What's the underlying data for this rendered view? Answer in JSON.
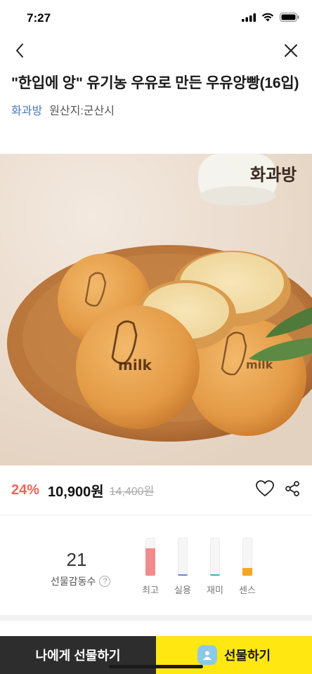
{
  "status_bar": {
    "time": "7:27"
  },
  "nav": {
    "back_icon": "chevron-left-icon",
    "close_icon": "close-icon"
  },
  "product": {
    "title": "\"한입에 앙\" 유기농 우유로 만든 우유앙빵(16입)",
    "brand": "화과방",
    "origin": "원산지:군산시",
    "hero_logo_text": "화과방",
    "hero_bread_text": "milk"
  },
  "price": {
    "discount": "24%",
    "sale_price": "10,900원",
    "original_price": "14,400원"
  },
  "stats": {
    "count": "21",
    "label": "선물감동수",
    "help_mark": "?",
    "bars": [
      {
        "label": "최고",
        "level": 0.72,
        "color": "#f28b8b"
      },
      {
        "label": "실용",
        "level": 0.04,
        "color": "#6b7fe0"
      },
      {
        "label": "재미",
        "level": 0.04,
        "color": "#3bb8b0"
      },
      {
        "label": "센스",
        "level": 0.2,
        "color": "#f5a623"
      }
    ]
  },
  "cta": {
    "self_gift": "나에게 선물하기",
    "gift": "선물하기"
  },
  "colors": {
    "brand_link": "#4a7ab8",
    "discount": "#f0645a",
    "cta_yellow": "#ffe812",
    "cta_dark": "#2d2d2d"
  }
}
